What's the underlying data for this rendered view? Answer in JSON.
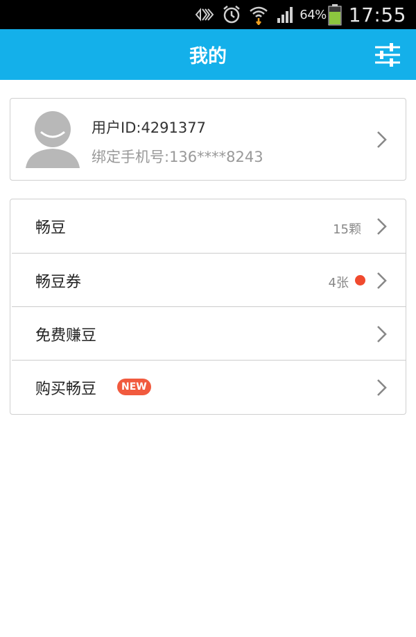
{
  "status_bar": {
    "battery_pct": "64%",
    "time": "17:55",
    "icons": [
      "nfc-icon",
      "alarm-icon",
      "wifi-icon",
      "signal-icon",
      "battery-icon"
    ]
  },
  "header": {
    "title": "我的",
    "settings_icon": "sliders-icon",
    "background_color": "#14b0ea"
  },
  "profile": {
    "user_id": "用户ID:4291377",
    "phone": "绑定手机号:136****8243"
  },
  "menu": {
    "items": [
      {
        "label": "畅豆",
        "value": "15颗"
      },
      {
        "label": "畅豆券",
        "value": "4张"
      },
      {
        "label": "免费赚豆"
      },
      {
        "label": "购买畅豆",
        "badge": "NEW"
      }
    ]
  }
}
